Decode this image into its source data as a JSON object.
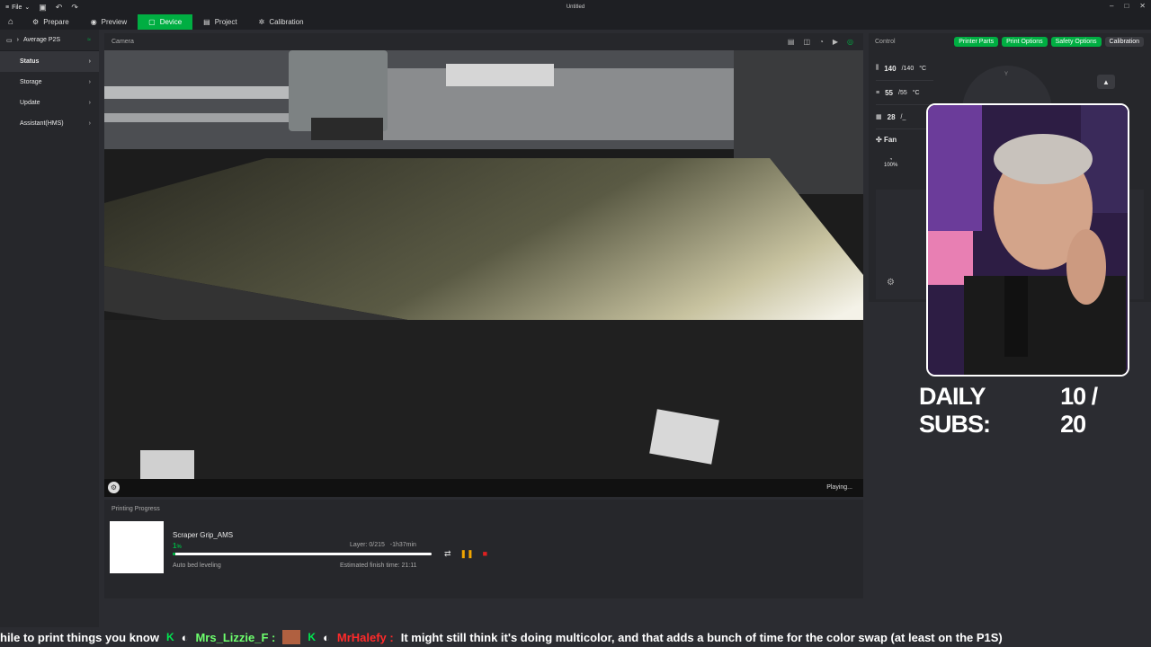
{
  "window": {
    "menu_label": "File",
    "title": "Untitled"
  },
  "tabs": [
    {
      "label": "Prepare"
    },
    {
      "label": "Preview"
    },
    {
      "label": "Device"
    },
    {
      "label": "Project"
    },
    {
      "label": "Calibration"
    }
  ],
  "sidebar": {
    "printer_name": "Average P2S",
    "items": [
      {
        "label": "Status"
      },
      {
        "label": "Storage"
      },
      {
        "label": "Update"
      },
      {
        "label": "Assistant(HMS)"
      }
    ]
  },
  "camera": {
    "header": "Camera",
    "status": "Playing..."
  },
  "printing": {
    "header": "Printing Progress",
    "name": "Scraper Grip_AMS",
    "percent": "1",
    "percent_unit": "%",
    "progress_fraction": 0.01,
    "layer": "Layer: 0/215",
    "remaining": "-1h37min",
    "stage": "Auto bed leveling",
    "finish": "Estimated finish time: 21:11"
  },
  "control": {
    "header": "Control",
    "buttons": [
      "Printer Parts",
      "Print Options",
      "Safety Options",
      "Calibration"
    ],
    "temps": [
      {
        "current": "140",
        "target": "/140",
        "unit": "°C"
      },
      {
        "current": "55",
        "target": "/55",
        "unit": "°C"
      },
      {
        "current": "28",
        "target": "/_",
        "unit": ""
      }
    ],
    "fan_label": "Fan",
    "speed": "100%",
    "jog_y": "Y"
  },
  "overlay": {
    "subs_label": "DAILY SUBS:",
    "subs_value": "10 / 20"
  },
  "chat": {
    "prefix": "hile to print things you know",
    "user1": "Mrs_Lizzie_F :",
    "user2": "MrHalefy :",
    "message": "It might still think it's doing multicolor, and that adds a bunch of time for the color swap (at least on the P1S)"
  }
}
